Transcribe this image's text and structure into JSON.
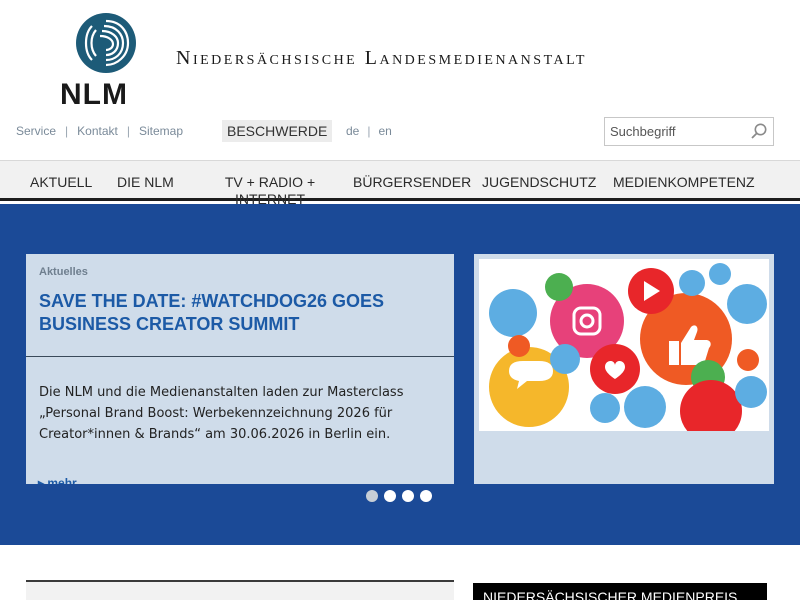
{
  "brand": {
    "logo_text": "NLM",
    "name": "Niedersächsische Landesmedienanstalt"
  },
  "utility_links": [
    "Service",
    "Kontakt",
    "Sitemap"
  ],
  "complaint_label": "BESCHWERDE",
  "languages": [
    "de",
    "en"
  ],
  "search": {
    "placeholder": "Suchbegriff",
    "value": ""
  },
  "nav": {
    "items": [
      "AKTUELL",
      "DIE NLM",
      "TV + RADIO + INTERNET",
      "BÜRGERSENDER",
      "JUGENDSCHUTZ",
      "MEDIENKOMPETENZ"
    ]
  },
  "hero": {
    "category": "Aktuelles",
    "title": "SAVE THE DATE: #WATCHDOG26 GOES BUSINESS CREATOR SUMMIT",
    "text": "Die NLM und die Medienanstalten laden zur Masterclass „Personal Brand Boost: Werbekennzeichnung 2026 für Creator*innen & Brands“ am 30.06.2026 in Berlin ein.",
    "more": "mehr",
    "slides": 4,
    "active_slide": 1
  },
  "award": {
    "label": "NIEDERSÄCHSISCHER MEDIENPREIS"
  },
  "colors": {
    "accent_blue": "#1b4a97",
    "title_blue": "#1c5aa6",
    "card_bg": "#cfdcea",
    "nav_bg": "#f1f1f1"
  }
}
